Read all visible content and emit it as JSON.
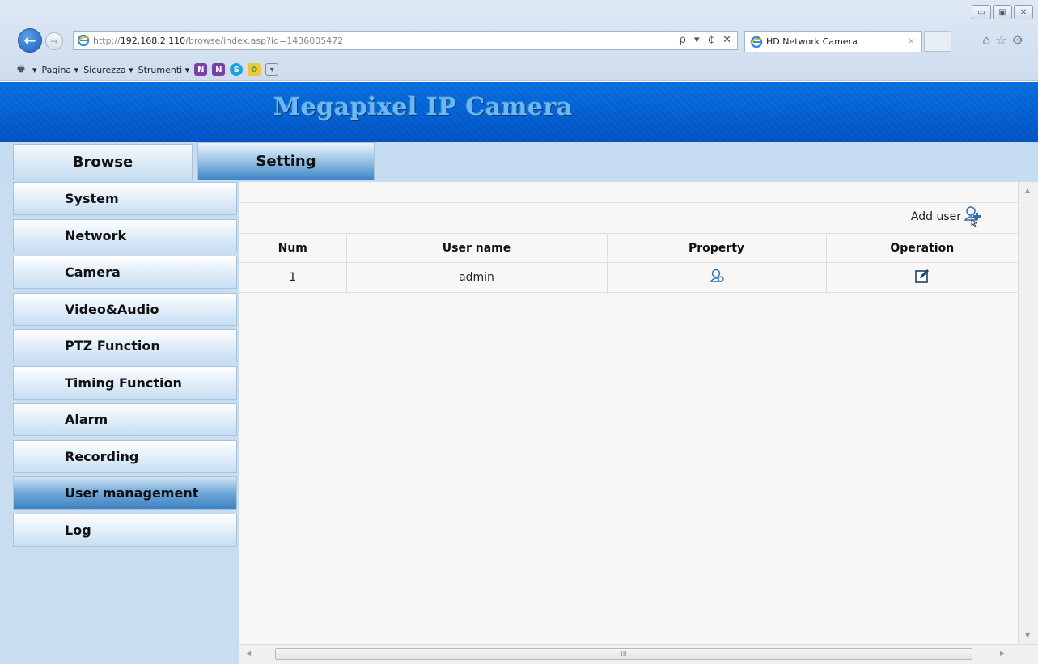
{
  "browser": {
    "url_prefix": "http://",
    "url_host": "192.168.2.110",
    "url_path": "/browse/index.asp?id=1436005472",
    "address_controls": "ρ ▾ ¢ ✕",
    "tab_title": "HD Network Camera",
    "tab_close": "×",
    "window_buttons": [
      "▭",
      "▣",
      "✕"
    ],
    "right_icons": "⌂☆⚙",
    "command_bar": {
      "print_arrow": "▾",
      "pagina": "Pagina ▾",
      "sicurezza": "Sicurezza ▾",
      "strumenti": "Strumenti ▾"
    }
  },
  "banner": {
    "title": "Megapixel IP Camera"
  },
  "topnav": {
    "browse": "Browse",
    "setting": "Setting"
  },
  "sidebar": {
    "items": [
      {
        "label": "System"
      },
      {
        "label": "Network"
      },
      {
        "label": "Camera"
      },
      {
        "label": "Video&Audio"
      },
      {
        "label": "PTZ Function"
      },
      {
        "label": "Timing Function"
      },
      {
        "label": "Alarm"
      },
      {
        "label": "Recording"
      },
      {
        "label": "User management"
      },
      {
        "label": "Log"
      }
    ],
    "active": "User management"
  },
  "content": {
    "add_user_label": "Add user",
    "table": {
      "headers": [
        "Num",
        "User name",
        "Property",
        "Operation"
      ],
      "rows": [
        {
          "num": "1",
          "user": "admin"
        }
      ]
    }
  },
  "scroll": {
    "thumb_grip": "III"
  }
}
